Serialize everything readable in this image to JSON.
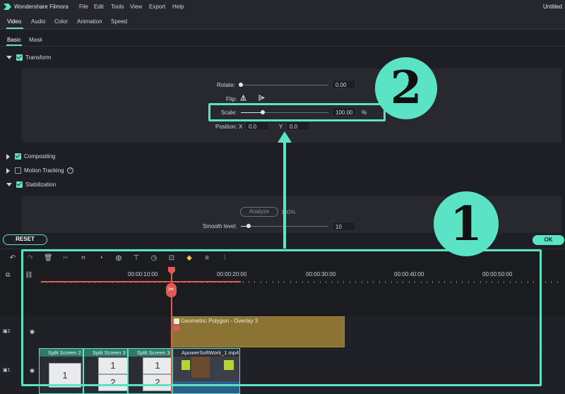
{
  "app": {
    "title": "Wondershare Filmora",
    "document_title": "Untitled",
    "menu": [
      "File",
      "Edit",
      "Tools",
      "View",
      "Export",
      "Help"
    ]
  },
  "tabs": [
    "Video",
    "Audio",
    "Color",
    "Animation",
    "Speed"
  ],
  "subtabs": [
    "Basic",
    "Mask"
  ],
  "transform": {
    "label": "Transform",
    "rotate": {
      "label": "Rotate:",
      "value": "0.00"
    },
    "flip": {
      "label": "Flip:"
    },
    "scale": {
      "label": "Scale:",
      "value": "100.00",
      "unit": "%"
    },
    "position": {
      "label": "Position:",
      "x_label": "X",
      "x_value": "0.0",
      "y_label": "Y",
      "y_value": "0.0"
    }
  },
  "compositing": {
    "label": "Compositing"
  },
  "motion_tracking": {
    "label": "Motion Tracking",
    "info": "?"
  },
  "stabilization": {
    "label": "Stabilization",
    "analyze_label": "Analyze",
    "analyze_percent": "100%",
    "smooth_label": "Smooth level:",
    "smooth_value": "10"
  },
  "buttons": {
    "reset": "RESET",
    "ok": "OK"
  },
  "timeline": {
    "ruler": [
      "00:00:10:00",
      "00:00:20:00",
      "00:00:30:00",
      "00:00:40:00",
      "00:00:50:00"
    ],
    "tracks": [
      {
        "label": "2",
        "clips": [
          {
            "title": "Geometric Polygon - Overlay 3"
          }
        ]
      },
      {
        "label": "1",
        "clips": [
          {
            "title": "Split Screen 2"
          },
          {
            "title": "Split Screen 3"
          },
          {
            "title": "Split Screen 3"
          },
          {
            "title": "ApowerSoftWork_1.mp4"
          }
        ]
      }
    ],
    "cells": [
      "1",
      "1",
      "1",
      "2",
      "2"
    ]
  },
  "annotations": {
    "first": "1",
    "second": "2"
  },
  "colors": {
    "accent": "#5be3c6",
    "playhead": "#e35a55",
    "overlay": "#8b7433"
  }
}
